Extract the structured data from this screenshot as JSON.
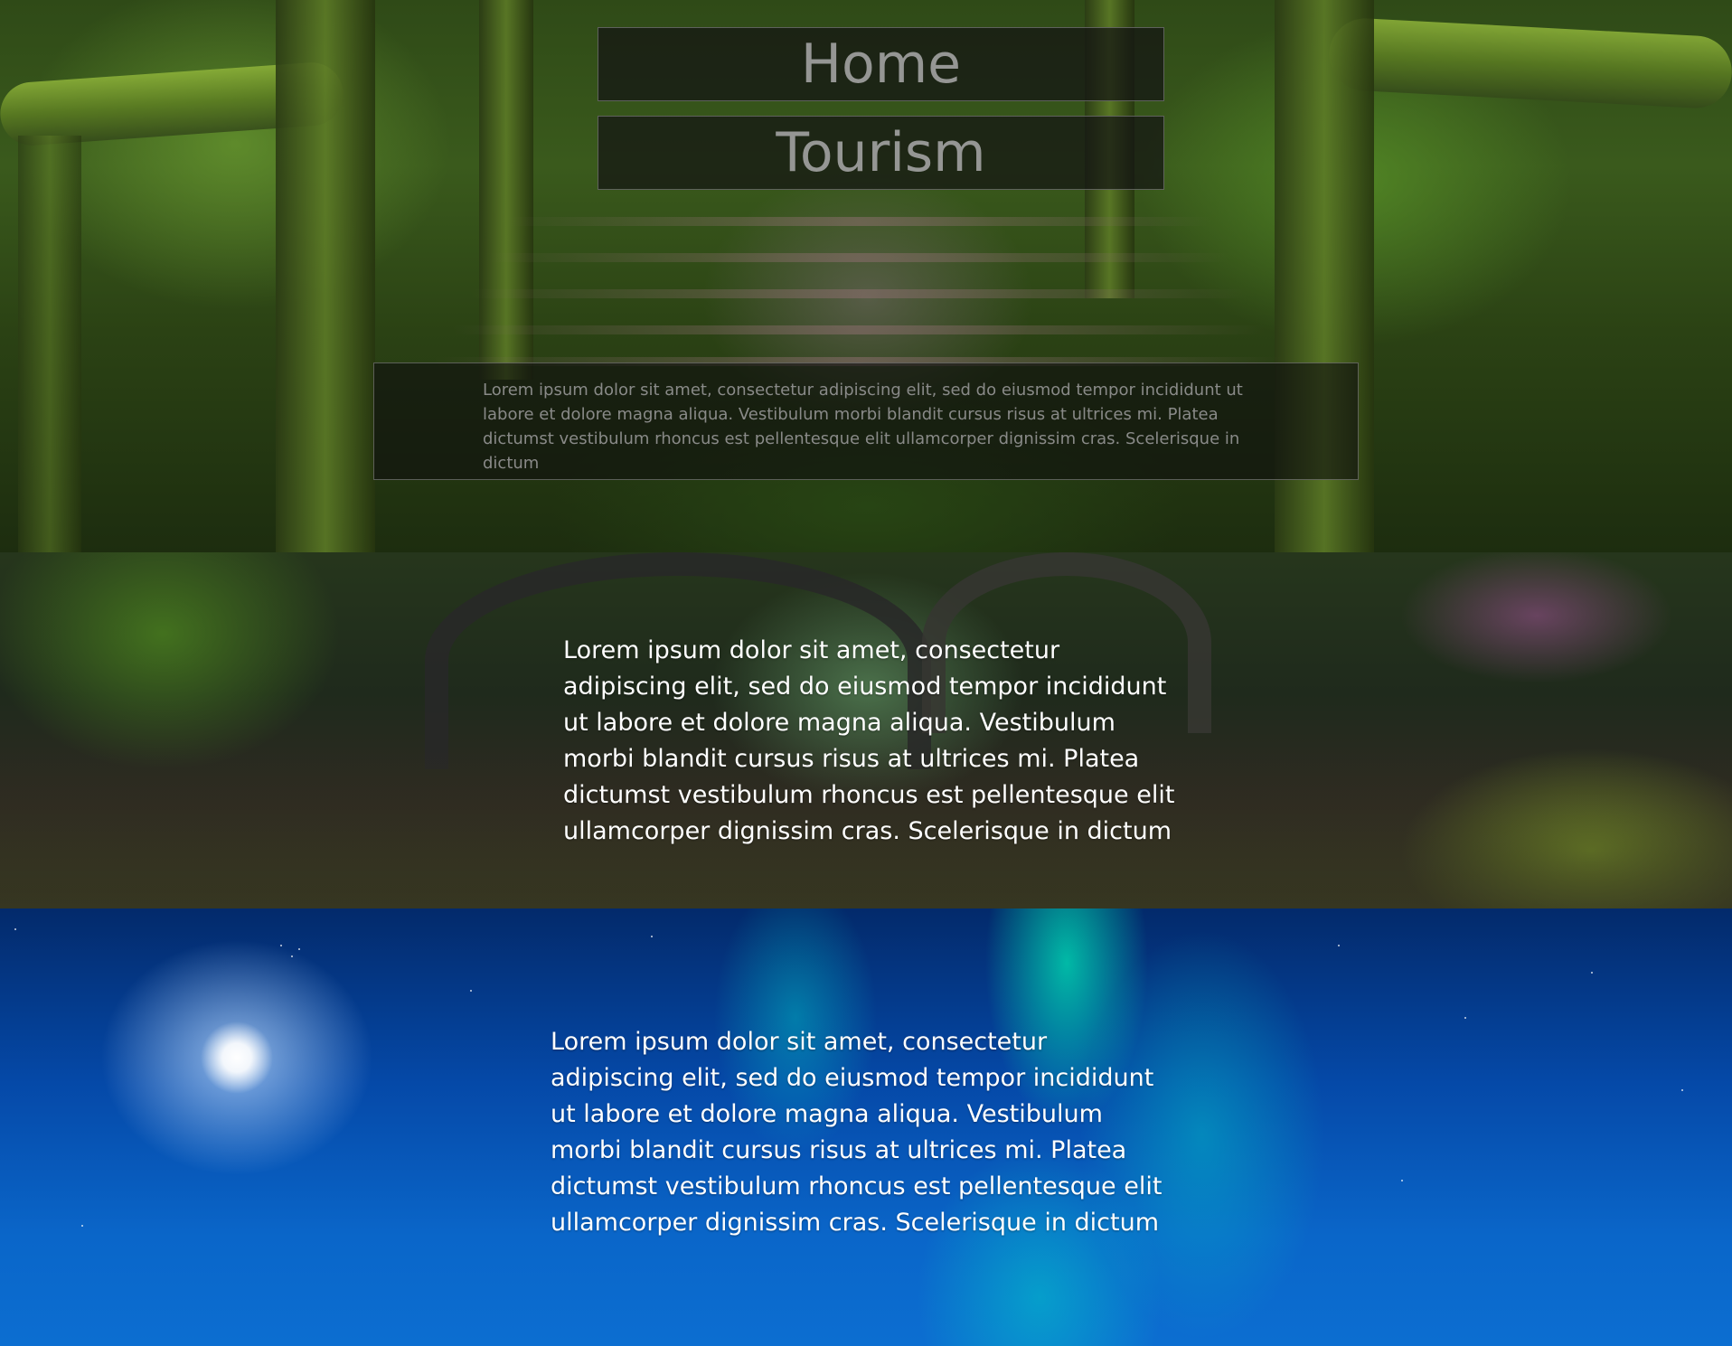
{
  "nav": {
    "home_label": "Home",
    "tourism_label": "Tourism"
  },
  "hero": {
    "intro_text": "Lorem ipsum dolor sit amet, consectetur adipiscing elit, sed do eiusmod tempor incididunt ut labore et dolore magna aliqua. Vestibulum morbi blandit cursus risus at ultrices mi. Platea dictumst vestibulum rhoncus est pellentesque elit ullamcorper dignissim cras. Scelerisque in dictum"
  },
  "river": {
    "text": "Lorem ipsum dolor sit amet, consectetur adipiscing elit, sed do eiusmod tempor incididunt ut labore et dolore magna aliqua. Vestibulum morbi blandit cursus risus at ultrices mi. Platea dictumst vestibulum rhoncus est pellentesque elit ullamcorper dignissim cras. Scelerisque in dictum"
  },
  "aurora": {
    "text": "Lorem ipsum dolor sit amet, consectetur adipiscing elit, sed do eiusmod tempor incididunt ut labore et dolore magna aliqua. Vestibulum morbi blandit cursus risus at ultrices mi. Platea dictumst vestibulum rhoncus est pellentesque elit ullamcorper dignissim cras. Scelerisque in dictum"
  },
  "theme": {
    "nav_box_bg": "#141414",
    "nav_text_color": "#aaaaaa",
    "body_text_color": "#ffffff"
  }
}
